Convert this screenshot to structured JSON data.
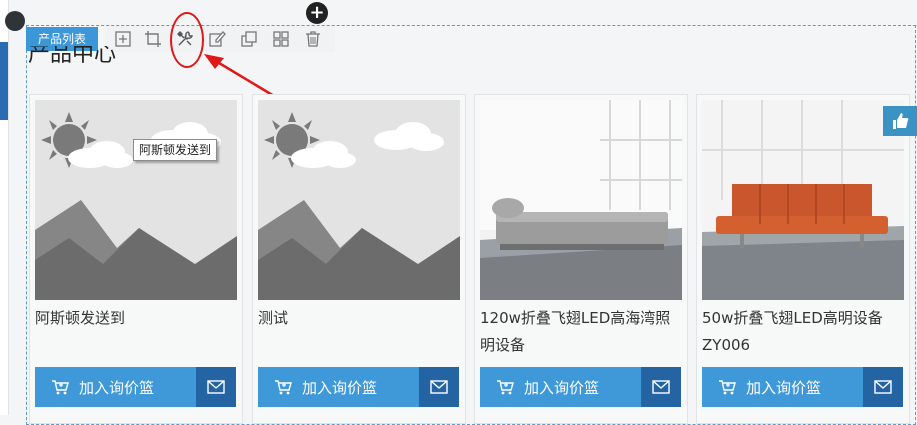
{
  "module": {
    "label": "产品列表",
    "title": "产品中心"
  },
  "toolbar": {
    "tools": [
      "add-icon",
      "crop-icon",
      "wrench-settings-icon",
      "edit-icon",
      "copy-icon",
      "grid-icon",
      "trash-icon"
    ],
    "highlight_tool": "wrench-settings-icon",
    "annotation_color": "#e01818"
  },
  "tooltip": {
    "text": "阿斯顿发送到"
  },
  "products": [
    {
      "name": "阿斯顿发送到",
      "image": "placeholder-landscape-icon",
      "cart_label": "加入询价篮"
    },
    {
      "name": "测试",
      "image": "placeholder-landscape-icon",
      "cart_label": "加入询价篮"
    },
    {
      "name": "120w折叠飞翅LED高海湾照明设备",
      "image": "grey-sofa-photo",
      "cart_label": "加入询价篮"
    },
    {
      "name": "50w折叠飞翅LED高明设备ZY006",
      "image": "orange-sofa-photo",
      "cart_label": "加入询价篮"
    }
  ],
  "colors": {
    "accent": "#3f98d8",
    "accent_dark": "#2464a2",
    "badge": "#3b97d8",
    "dashed_border": "#5b9bd5"
  }
}
